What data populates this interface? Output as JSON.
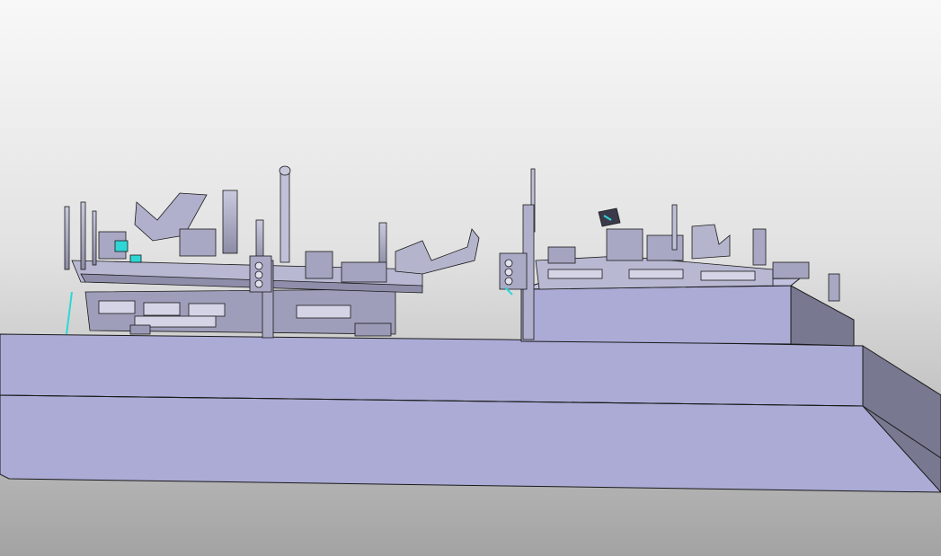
{
  "viewport": {
    "background_top": "#f8f8f8",
    "background_bottom": "#a3a3a3",
    "face_light": "#ababd6",
    "face_dark": "#787890",
    "edge_color": "#1a1a1a",
    "highlight_color": "#2fd6d6"
  },
  "scene": {
    "objects": [
      {
        "name": "base-platform",
        "icon": "box-shape"
      },
      {
        "name": "raised-block",
        "icon": "box-shape"
      },
      {
        "name": "fixture-assembly-left",
        "icon": "machine-part"
      },
      {
        "name": "fixture-assembly-right",
        "icon": "machine-part"
      },
      {
        "name": "locating-pin-tall-left",
        "icon": "pin-shape"
      },
      {
        "name": "locating-pin-tall-center",
        "icon": "pin-shape"
      }
    ]
  }
}
